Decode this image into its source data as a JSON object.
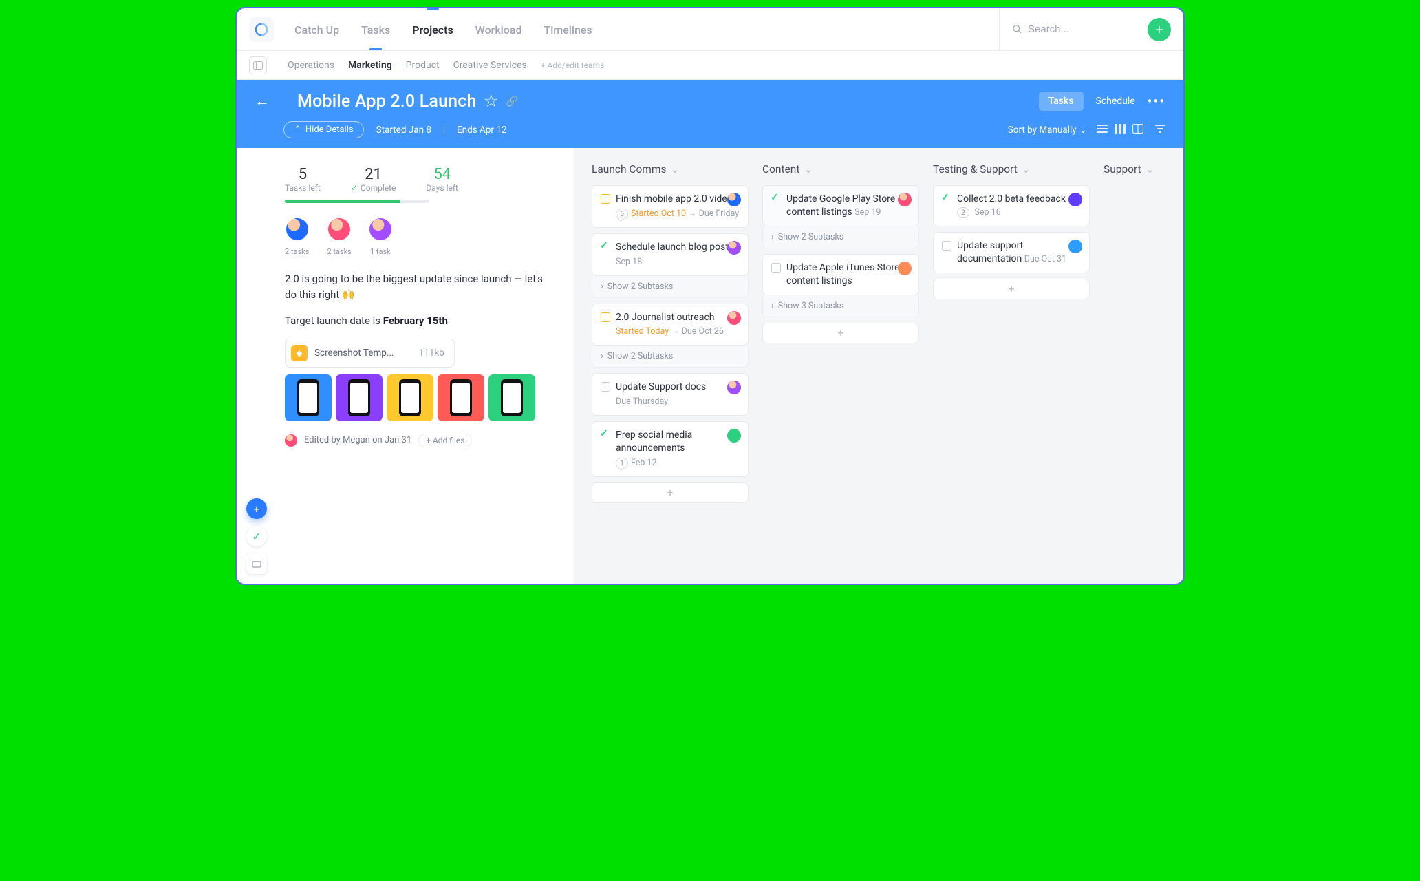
{
  "topnav": {
    "items": [
      "Catch Up",
      "Tasks",
      "Projects",
      "Workload",
      "Timelines"
    ],
    "activeIndex": 2,
    "searchPlaceholder": "Search..."
  },
  "subnav": {
    "items": [
      "Operations",
      "Marketing",
      "Product",
      "Creative Services"
    ],
    "activeIndex": 1,
    "addLabel": "+ Add/edit teams"
  },
  "project": {
    "title": "Mobile App 2.0 Launch",
    "tabs": {
      "tasks": "Tasks",
      "schedule": "Schedule"
    },
    "hideDetails": "Hide Details",
    "started": "Started Jan 8",
    "ends": "Ends Apr 12",
    "sortBy": "Sort by Manually"
  },
  "details": {
    "stats": {
      "tasksLeftN": "5",
      "tasksLeftL": "Tasks left",
      "completeN": "21",
      "completeL": "Complete",
      "daysLeftN": "54",
      "daysLeftL": "Days left"
    },
    "assignees": [
      {
        "count": "2 tasks"
      },
      {
        "count": "2 tasks"
      },
      {
        "count": "1 task"
      }
    ],
    "descLine1a": "2.0 is going to be the biggest update since launch — let's do this right ",
    "descLine1emoji": "🙌",
    "descLine2a": "Target launch date is ",
    "descLine2b": "February 15th",
    "attachment": {
      "name": "Screenshot Temp...",
      "size": "111kb"
    },
    "editedBy": "Edited by Megan on Jan 31",
    "addFiles": "+ Add files"
  },
  "board": {
    "columns": [
      {
        "title": "Launch Comms",
        "cards": [
          {
            "status": "pend",
            "title": "Finish mobile app 2.0 video",
            "metaPill": "5",
            "metaOrange": "Started Oct 10",
            "metaRest": "Due Friday",
            "arrow": true,
            "av": "avA"
          },
          {
            "status": "done",
            "title": "Schedule launch blog post",
            "metaRest": "Sep 18",
            "av": "avC",
            "subtasks": "Show 2 Subtasks"
          },
          {
            "status": "pend",
            "title": "2.0 Journalist outreach",
            "metaOrange": "Started Today",
            "metaRest": "Due Oct 26",
            "arrow": true,
            "av": "avB",
            "subtasks": "Show 2 Subtasks"
          },
          {
            "status": "open",
            "title": "Update Support docs",
            "metaRest": "Due Thursday",
            "av": "avC"
          },
          {
            "status": "done",
            "title": "Prep social media announcements",
            "metaPill": "1",
            "metaRest": "Feb 12",
            "av": "avE"
          }
        ]
      },
      {
        "title": "Content",
        "cards": [
          {
            "status": "done",
            "title": "Update Google Play Store content listings",
            "metaInline": "Sep 19",
            "av": "avB",
            "subtasks": "Show 2 Subtasks",
            "shade": true
          },
          {
            "status": "open",
            "title": "Update Apple iTunes Store content listings",
            "av": "avD",
            "subtasks": "Show 3 Subtasks"
          }
        ]
      },
      {
        "title": "Testing & Support",
        "cards": [
          {
            "status": "done",
            "title": "Collect 2.0 beta feedback",
            "metaPillInline": "2",
            "metaInline": "Sep 16",
            "av": "avF"
          },
          {
            "status": "open",
            "title": "Update support documentation",
            "metaInline": "Due Oct 31",
            "av": "avG"
          }
        ]
      },
      {
        "title": "Support",
        "cards": []
      }
    ],
    "showSubtasksArrow": "›"
  }
}
